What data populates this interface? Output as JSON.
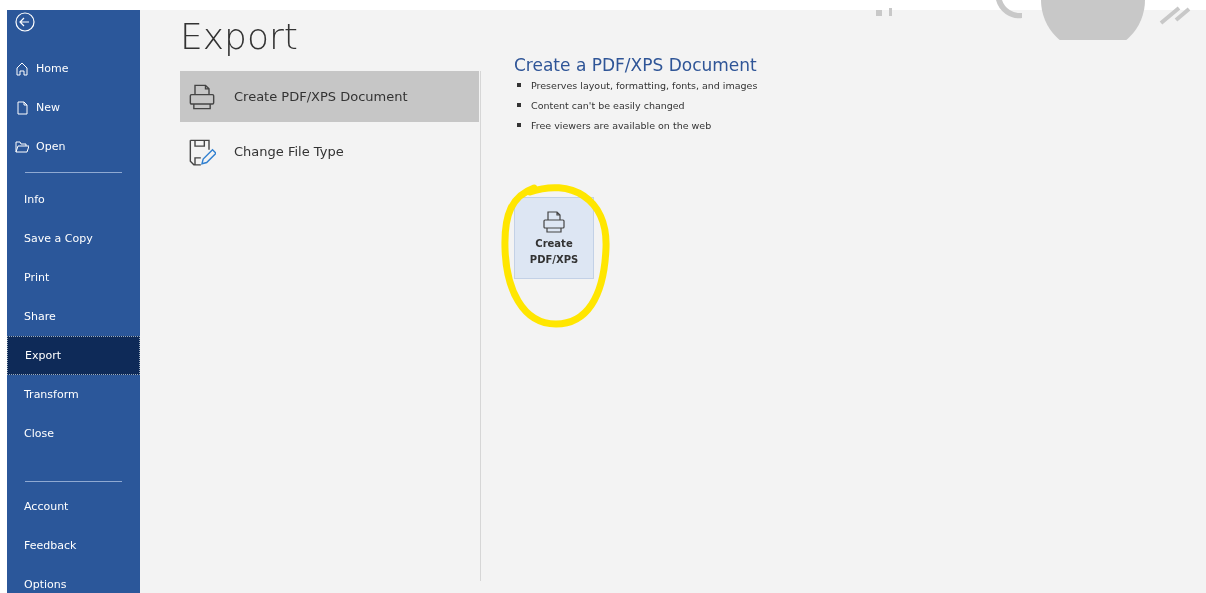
{
  "sidebar": {
    "groups": [
      {
        "items": [
          {
            "label": "Home",
            "kind": "home",
            "selected": false
          },
          {
            "label": "New",
            "kind": "new",
            "selected": false
          },
          {
            "label": "Open",
            "kind": "open",
            "selected": false
          }
        ]
      },
      {
        "items": [
          {
            "label": "Info",
            "kind": "plain",
            "selected": false
          },
          {
            "label": "Save a Copy",
            "kind": "plain",
            "selected": false
          },
          {
            "label": "Print",
            "kind": "plain",
            "selected": false
          },
          {
            "label": "Share",
            "kind": "plain",
            "selected": false
          },
          {
            "label": "Export",
            "kind": "plain",
            "selected": true
          },
          {
            "label": "Transform",
            "kind": "plain",
            "selected": false
          },
          {
            "label": "Close",
            "kind": "plain",
            "selected": false
          }
        ]
      },
      {
        "items": [
          {
            "label": "Account",
            "kind": "plain",
            "selected": false
          },
          {
            "label": "Feedback",
            "kind": "plain",
            "selected": false
          },
          {
            "label": "Options",
            "kind": "plain",
            "selected": false
          }
        ]
      }
    ]
  },
  "page_title": "Export",
  "export_options": [
    {
      "label": "Create PDF/XPS Document",
      "kind": "pdf",
      "selected": true
    },
    {
      "label": "Change File Type",
      "kind": "filetype",
      "selected": false
    }
  ],
  "detail": {
    "heading": "Create a PDF/XPS Document",
    "bullets": [
      "Preserves layout, formatting, fonts, and images",
      "Content can't be easily changed",
      "Free viewers are available on the web"
    ],
    "button": {
      "lines": [
        "Create",
        "PDF/XPS"
      ]
    }
  }
}
